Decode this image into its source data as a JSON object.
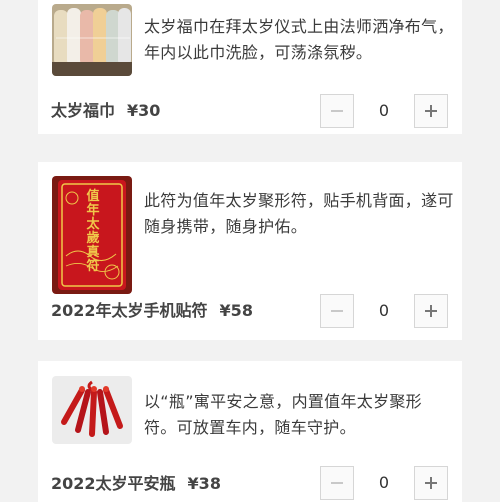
{
  "products": [
    {
      "description": "太岁福巾在拜太岁仪式上由法师洒净布气，年内以此巾洗脸，可荡涤氛秽。",
      "name": "太岁福巾",
      "price": "¥30",
      "quantity": "0",
      "image_icon": "towels-image"
    },
    {
      "description": "此符为值年太岁聚形符，贴手机背面，遂可随身携带，随身护佑。",
      "name": "2022年太岁手机贴符",
      "price": "¥58",
      "quantity": "0",
      "image_icon": "phone-talisman-image",
      "image_text": "值年太歲真符"
    },
    {
      "description": "以“瓶”寓平安之意，内置值年太岁聚形符。可放置车内，随车守护。",
      "name": "2022太岁平安瓶",
      "price": "¥38",
      "quantity": "0",
      "image_icon": "red-tassels-image"
    }
  ],
  "colors": {
    "background": "#f2f2f2",
    "card": "#ffffff",
    "talisman_red": "#c8161d",
    "talisman_gold": "#f0c84a"
  }
}
